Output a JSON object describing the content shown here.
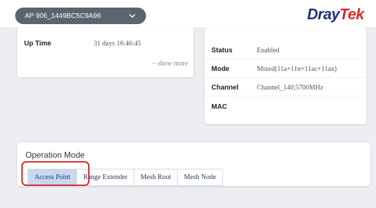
{
  "header": {
    "device_name": "AP 906_1449BC5C9A96",
    "logo_dray": "Dray",
    "logo_tek": "Tek"
  },
  "system_card": {
    "uptime_label": "Up Time",
    "uptime_value": "31 days 16:46:45",
    "show_more": "– show more"
  },
  "wireless_card": {
    "rows": [
      {
        "label": "Status",
        "value": "Enabled"
      },
      {
        "label": "Mode",
        "value": "Mixed(11a+11n+11ac+11ax)"
      },
      {
        "label": "Channel",
        "value": "Channel_140,5700MHz"
      },
      {
        "label": "MAC",
        "value": ""
      }
    ]
  },
  "operation_mode": {
    "title": "Operation Mode",
    "tabs": [
      {
        "label": "Access Point",
        "active": true
      },
      {
        "label": "Range Extender",
        "active": false
      },
      {
        "label": "Mesh Root",
        "active": false
      },
      {
        "label": "Mesh Node",
        "active": false
      }
    ]
  },
  "colors": {
    "accent_tab": "#c8d9ef",
    "highlight": "#d52a2a",
    "logo_blue": "#1f2f7a",
    "logo_red": "#d8262c"
  }
}
